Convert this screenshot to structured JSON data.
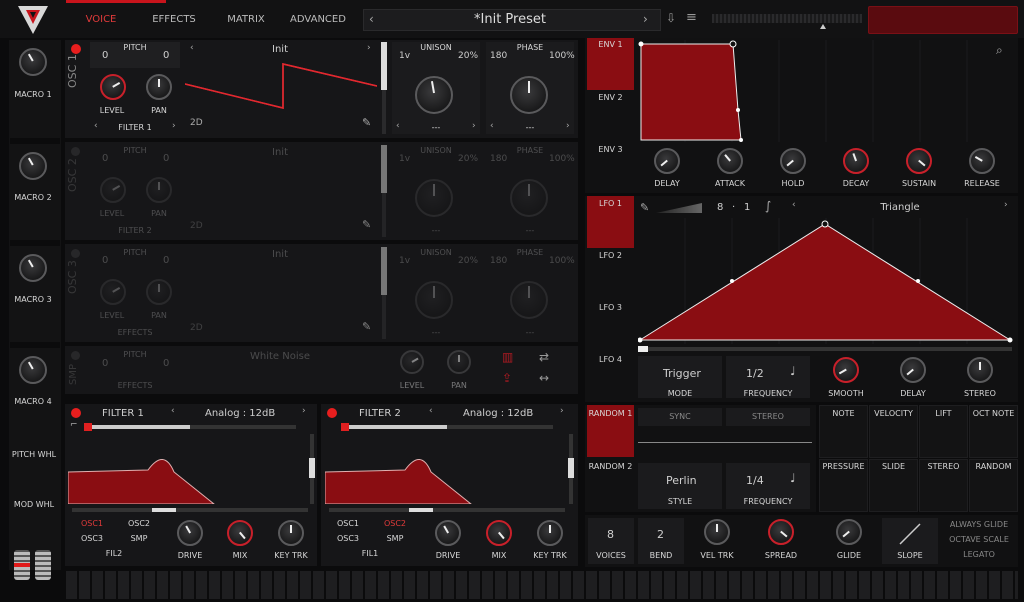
{
  "header": {
    "tabs": [
      "VOICE",
      "EFFECTS",
      "MATRIX",
      "ADVANCED"
    ],
    "preset": "*Init Preset"
  },
  "macros": [
    "MACRO 1",
    "MACRO 2",
    "MACRO 3",
    "MACRO 4"
  ],
  "wheels": [
    "PITCH WHL",
    "MOD WHL"
  ],
  "osc1": {
    "name": "OSC 1",
    "pitch_label": "PITCH",
    "pitch_l": "0",
    "pitch_r": "0",
    "level": "LEVEL",
    "pan": "PAN",
    "filter": "FILTER 1",
    "wave": "Init",
    "mode": "2D",
    "unison": "UNISON",
    "uni_v": "1v",
    "uni_pct": "20%",
    "phase": "PHASE",
    "phase_v": "180",
    "phase_pct": "100%",
    "dash": "---"
  },
  "osc2": {
    "name": "OSC 2",
    "filter": "FILTER 2",
    "wave": "Init",
    "mode": "2D"
  },
  "osc3": {
    "name": "OSC 3",
    "filter": "EFFECTS",
    "wave": "Init",
    "mode": "2D"
  },
  "smp": {
    "name": "SMP",
    "filter": "EFFECTS",
    "wave": "White Noise"
  },
  "filter1": {
    "name": "FILTER 1",
    "type": "Analog : 12dB",
    "src": [
      "OSC1",
      "OSC2",
      "OSC3",
      "SMP"
    ],
    "fil": "FIL2",
    "drive": "DRIVE",
    "mix": "MIX",
    "key": "KEY TRK"
  },
  "filter2": {
    "name": "FILTER 2",
    "type": "Analog : 12dB",
    "src": [
      "OSC1",
      "OSC2",
      "OSC3",
      "SMP"
    ],
    "fil": "FIL1",
    "drive": "DRIVE",
    "mix": "MIX",
    "key": "KEY TRK"
  },
  "env": {
    "tabs": [
      "ENV 1",
      "ENV 2",
      "ENV 3"
    ],
    "knobs": [
      "DELAY",
      "ATTACK",
      "HOLD",
      "DECAY",
      "SUSTAIN",
      "RELEASE"
    ]
  },
  "lfo": {
    "tabs": [
      "LFO 1",
      "LFO 2",
      "LFO 3",
      "LFO 4"
    ],
    "num": "8",
    "den": "1",
    "shape": "Triangle",
    "mode_v": "Trigger",
    "mode": "MODE",
    "freq_v": "1/2",
    "freq": "FREQUENCY",
    "smooth": "SMOOTH",
    "delay": "DELAY",
    "stereo": "STEREO"
  },
  "random": {
    "tabs": [
      "RANDOM 1",
      "RANDOM 2"
    ],
    "sync": "SYNC",
    "stereo": "STEREO",
    "style_v": "Perlin",
    "style": "STYLE",
    "freq_v": "1/4",
    "freq": "FREQUENCY"
  },
  "mod_sources": [
    "NOTE",
    "VELOCITY",
    "LIFT",
    "OCT NOTE",
    "PRESSURE",
    "SLIDE",
    "STEREO",
    "RANDOM"
  ],
  "voice": {
    "voices_v": "8",
    "voices": "VOICES",
    "bend_v": "2",
    "bend": "BEND",
    "vel": "VEL TRK",
    "spread": "SPREAD",
    "glide": "GLIDE",
    "slope": "SLOPE",
    "opts": [
      "ALWAYS GLIDE",
      "OCTAVE SCALE",
      "LEGATO"
    ]
  }
}
